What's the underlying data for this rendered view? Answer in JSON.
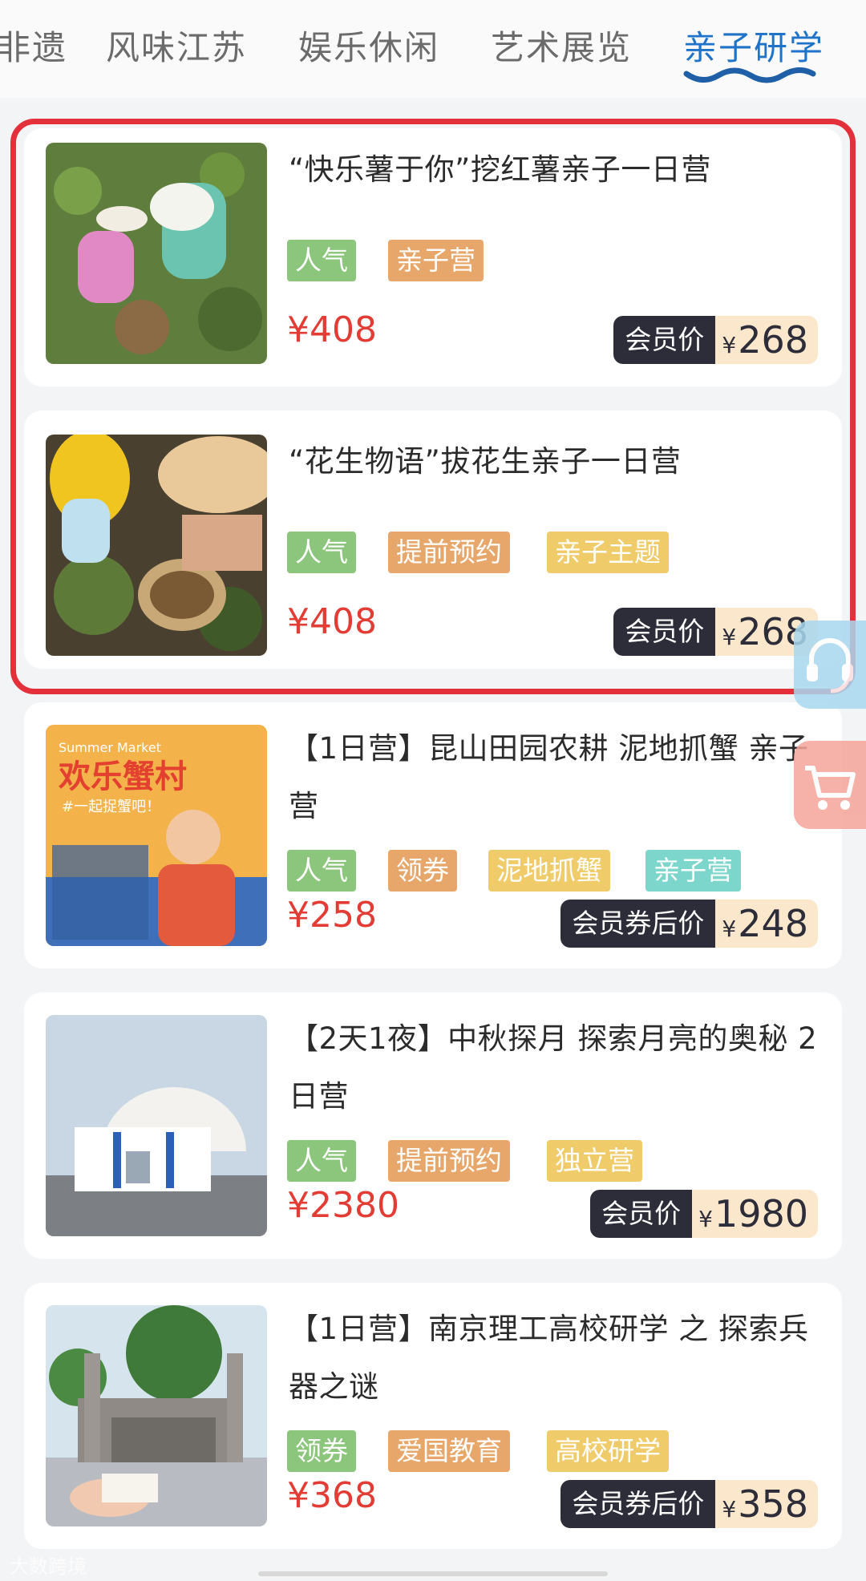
{
  "tabs": [
    {
      "label": "非遗",
      "active": false
    },
    {
      "label": "风味江苏",
      "active": false
    },
    {
      "label": "娱乐休闲",
      "active": false
    },
    {
      "label": "艺术展览",
      "active": false
    },
    {
      "label": "亲子研学",
      "active": true
    }
  ],
  "colors": {
    "accent": "#1f73c8",
    "price": "#e23c34",
    "highlight": "#e4303a",
    "tag_green": "#8cc57c",
    "tag_orange": "#e8a76a",
    "tag_yellow": "#f0cb6a",
    "tag_teal": "#7dd6cb"
  },
  "products": [
    {
      "title": "“快乐薯于你”挖红薯亲子一日营",
      "tags": [
        "人气",
        "亲子营"
      ],
      "price": "¥408",
      "member_label": "会员价",
      "member_currency": "¥",
      "member_price": "268"
    },
    {
      "title": "“花生物语”拔花生亲子一日营",
      "tags": [
        "人气",
        "提前预约",
        "亲子主题"
      ],
      "price": "¥408",
      "member_label": "会员价",
      "member_currency": "¥",
      "member_price": "268"
    },
    {
      "title": "【1日营】昆山田园农耕 泥地抓蟹 亲子营",
      "tags": [
        "人气",
        "领券",
        "泥地抓蟹",
        "亲子营"
      ],
      "price": "¥258",
      "member_label": "会员券后价",
      "member_currency": "¥",
      "member_price": "248",
      "image_text": {
        "sub": "Summer Market",
        "title": "欢乐蟹村",
        "slogan": "#一起捉蟹吧！"
      }
    },
    {
      "title": "【2天1夜】中秋探月 探索月亮的奥秘 2日营",
      "tags": [
        "人气",
        "提前预约",
        "独立营"
      ],
      "price": "¥2380",
      "member_label": "会员价",
      "member_currency": "¥",
      "member_price": "1980"
    },
    {
      "title": "【1日营】南京理工高校研学 之 探索兵器之谜",
      "tags": [
        "领券",
        "爱国教育",
        "高校研学"
      ],
      "price": "¥368",
      "member_label": "会员券后价",
      "member_currency": "¥",
      "member_price": "358"
    }
  ],
  "floating": {
    "service_icon": "headset-icon",
    "cart_icon": "cart-icon"
  },
  "watermark": "大数跨境"
}
